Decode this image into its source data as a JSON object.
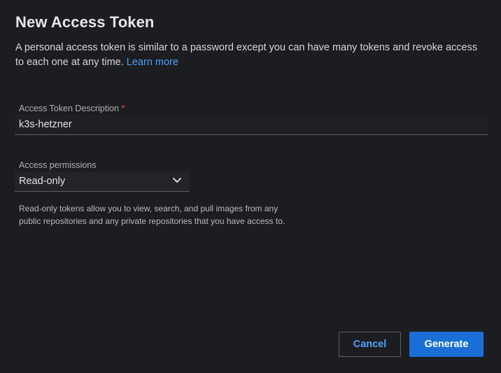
{
  "dialog": {
    "title": "New Access Token",
    "description": "A personal access token is similar to a password except you can have many tokens and revoke access to each one at any time.",
    "learn_more": "Learn more"
  },
  "token_description": {
    "label": "Access Token Description",
    "required_marker": "*",
    "value": "k3s-hetzner"
  },
  "permissions": {
    "label": "Access permissions",
    "selected": "Read-only",
    "icon": "chevron-down-icon",
    "help_text": "Read-only tokens allow you to view, search, and pull images from any public repositories and any private repositories that you have access to."
  },
  "actions": {
    "cancel_label": "Cancel",
    "generate_label": "Generate"
  },
  "colors": {
    "background": "#1c1d20",
    "accent": "#1a6fd6",
    "link": "#4ea1ff",
    "required": "#ff4d4d"
  }
}
